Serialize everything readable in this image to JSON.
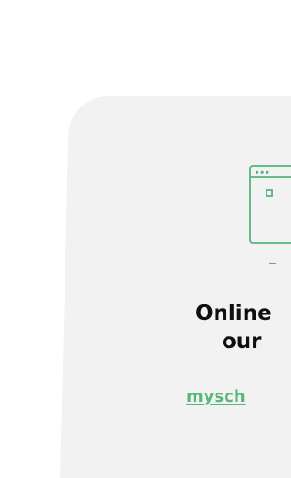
{
  "hero": {
    "title_line1": "Online",
    "title_line2": "our",
    "link_text": "mysch"
  },
  "icons": {
    "browser_window": "browser-window-icon"
  },
  "colors": {
    "background": "#ffffff",
    "card_background": "#f1f2f1",
    "accent_green": "#56b47a",
    "title_text": "#0f0f0f"
  }
}
